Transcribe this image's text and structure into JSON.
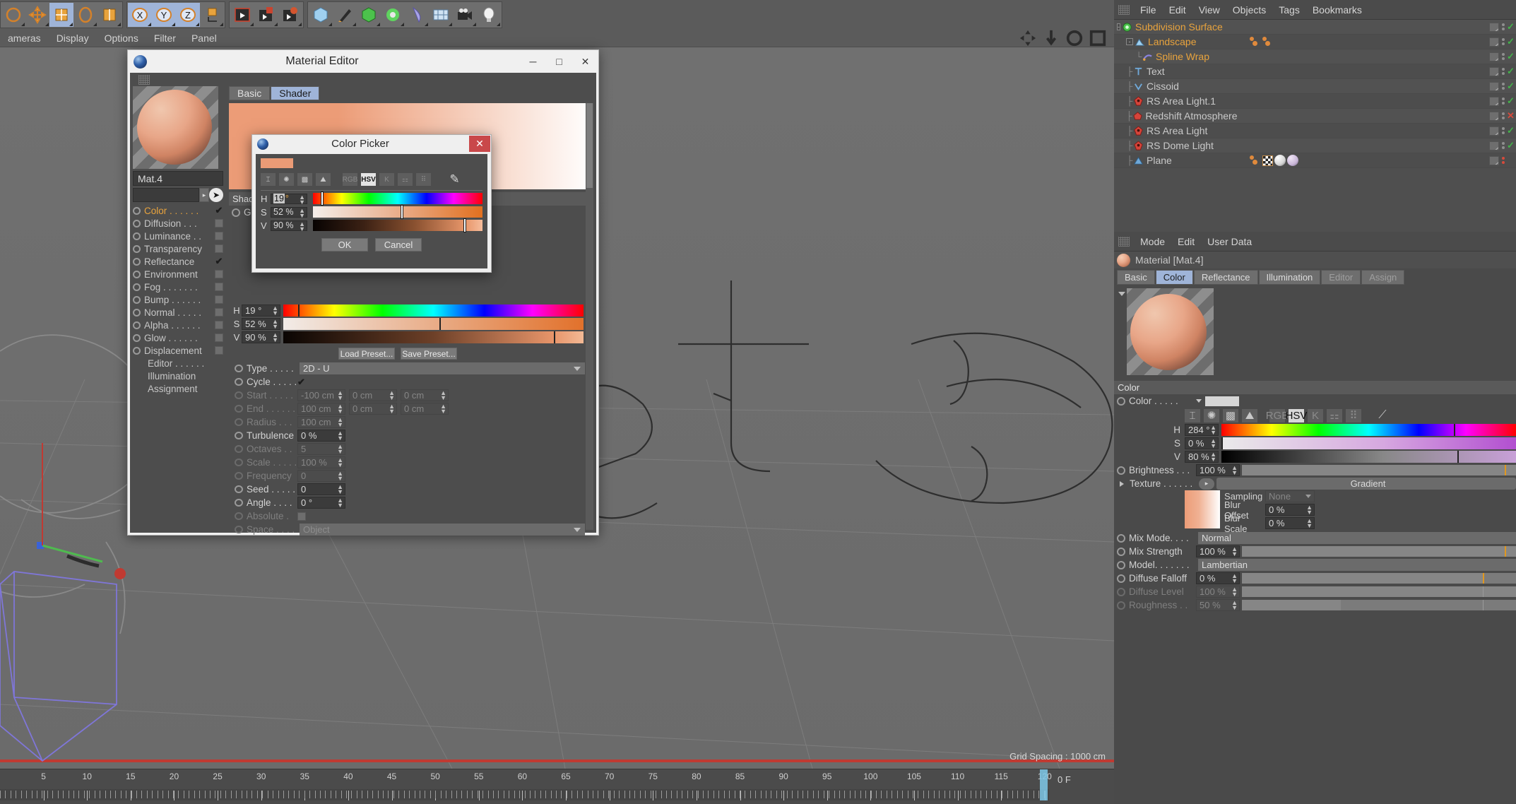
{
  "toolbar": {
    "groups": [
      {
        "name": "transform",
        "buttons": [
          {
            "icon": "undo-icon",
            "selected": false
          },
          {
            "icon": "move-icon",
            "selected": false
          },
          {
            "icon": "scale-icon",
            "selected": true
          },
          {
            "icon": "rotate-icon",
            "selected": false
          },
          {
            "icon": "scale2-icon",
            "selected": false
          }
        ]
      },
      {
        "name": "axis",
        "buttons": [
          {
            "icon": "x-axis-icon",
            "label": "X",
            "selected": true
          },
          {
            "icon": "y-axis-icon",
            "label": "Y",
            "selected": true
          },
          {
            "icon": "z-axis-icon",
            "label": "Z",
            "selected": true
          },
          {
            "icon": "world-axis-icon",
            "selected": false
          }
        ]
      },
      {
        "name": "render",
        "buttons": [
          {
            "icon": "render-view-icon",
            "selected": false
          },
          {
            "icon": "render-picture-viewer-icon",
            "selected": false
          },
          {
            "icon": "render-settings-icon",
            "selected": false
          }
        ]
      },
      {
        "name": "objects",
        "buttons": [
          {
            "icon": "cube-icon",
            "selected": false
          },
          {
            "icon": "pen-spline-icon",
            "selected": false
          },
          {
            "icon": "generator-icon",
            "selected": false
          },
          {
            "icon": "deformer-icon",
            "selected": false
          },
          {
            "icon": "bend-icon",
            "selected": false
          },
          {
            "icon": "environment-icon",
            "selected": false
          },
          {
            "icon": "camera-icon",
            "selected": false
          },
          {
            "icon": "light-icon",
            "selected": false
          }
        ]
      }
    ]
  },
  "viewport_menu": {
    "items": [
      "ameras",
      "Display",
      "Options",
      "Filter",
      "Panel"
    ],
    "right_icons": [
      "axis-move-icon",
      "arrow-down-icon",
      "rotate-icon",
      "panel-icon"
    ]
  },
  "viewport": {
    "grid_spacing_label": "Grid Spacing : 1000 cm"
  },
  "timeline": {
    "ticks": [
      "5",
      "10",
      "15",
      "20",
      "25",
      "30",
      "35",
      "40",
      "45",
      "50",
      "55",
      "60",
      "65",
      "70",
      "75",
      "80",
      "85",
      "90",
      "95",
      "100",
      "105",
      "110",
      "115",
      "120"
    ],
    "current_frame": "0 F"
  },
  "object_manager": {
    "menu": [
      "File",
      "Edit",
      "View",
      "Objects",
      "Tags",
      "Bookmarks"
    ],
    "rows": [
      {
        "label": "Subdivision Surface",
        "icon": "subdivision-surface-icon",
        "color": "orange",
        "depth": 0,
        "expander": "-",
        "state": "check",
        "tags": []
      },
      {
        "label": "Landscape",
        "icon": "landscape-icon",
        "color": "orange",
        "depth": 1,
        "expander": "-",
        "state": "check",
        "tags": [
          "material-orange",
          "material-orange"
        ]
      },
      {
        "label": "Spline Wrap",
        "icon": "spline-wrap-icon",
        "color": "orange",
        "depth": 2,
        "expander": "",
        "state": "check",
        "tags": []
      },
      {
        "label": "Text",
        "icon": "text-icon",
        "color": "grey",
        "depth": 1,
        "expander": "",
        "state": "check",
        "tags": []
      },
      {
        "label": "Cissoid",
        "icon": "cissoid-icon",
        "color": "grey",
        "depth": 1,
        "expander": "",
        "state": "check",
        "tags": []
      },
      {
        "label": "RS Area Light.1",
        "icon": "light-red-icon",
        "color": "grey",
        "depth": 1,
        "expander": "",
        "state": "check",
        "tags": []
      },
      {
        "label": "Redshift Atmosphere",
        "icon": "atmosphere-icon",
        "color": "grey",
        "depth": 1,
        "expander": "",
        "state": "cross",
        "tags": []
      },
      {
        "label": "RS Area Light",
        "icon": "light-red-icon",
        "color": "grey",
        "depth": 1,
        "expander": "",
        "state": "check",
        "tags": []
      },
      {
        "label": "RS Dome Light",
        "icon": "light-red-icon",
        "color": "grey",
        "depth": 1,
        "expander": "",
        "state": "check",
        "tags": []
      },
      {
        "label": "Plane",
        "icon": "plane-icon",
        "color": "grey",
        "depth": 1,
        "expander": "",
        "state": "reddots",
        "tags": [
          "material-orange",
          "checker-tag",
          "white-ball",
          "lilac-ball"
        ]
      }
    ]
  },
  "attribute_manager": {
    "menu": [
      "Mode",
      "Edit",
      "User Data"
    ],
    "header": "Material [Mat.4]",
    "tabs": [
      {
        "label": "Basic",
        "active": false
      },
      {
        "label": "Color",
        "active": true
      },
      {
        "label": "Reflectance",
        "active": false
      },
      {
        "label": "Illumination",
        "active": false
      },
      {
        "label": "Editor",
        "active": false,
        "dim": true
      },
      {
        "label": "Assign",
        "active": false,
        "dim": true
      }
    ],
    "section_title": "Color",
    "color_row_label": "Color . . . . .",
    "color_swatch": "#d6d6d6",
    "color_modes": [
      {
        "name": "range-icon",
        "active": false
      },
      {
        "name": "color-wheel-icon",
        "active": false
      },
      {
        "name": "gradient-icon",
        "active": false
      },
      {
        "name": "image-picker-icon",
        "active": false
      },
      {
        "name": "RGB",
        "active": false,
        "dim": true
      },
      {
        "name": "HSV",
        "active": true
      },
      {
        "name": "K",
        "active": false,
        "dim": true
      },
      {
        "name": "sliders-icon",
        "active": false,
        "dim": true
      },
      {
        "name": "swatches-icon",
        "active": false,
        "dim": true
      },
      {
        "name": "eyedropper-icon",
        "active": false
      }
    ],
    "hsv": [
      {
        "channel": "H",
        "value": "284 °",
        "cursor_pct": 78.9
      },
      {
        "channel": "S",
        "value": "0 %",
        "cursor_pct": 0
      },
      {
        "channel": "V",
        "value": "80 %",
        "cursor_pct": 80
      }
    ],
    "params": [
      {
        "label": "Brightness . . .",
        "value": "100 %",
        "type": "slider",
        "fill": 100,
        "mark": 96,
        "dim": false,
        "radio": true
      },
      {
        "label": "Texture . . . . . .",
        "value": "Gradient",
        "type": "texture",
        "dim": false,
        "radio": false
      },
      {
        "label": "Mix Mode. . . .",
        "value": "Normal",
        "type": "combo",
        "dim": false,
        "radio": true
      },
      {
        "label": "Mix Strength",
        "value": "100 %",
        "type": "slider",
        "fill": 100,
        "mark": 96,
        "dim": false,
        "radio": true
      },
      {
        "label": "Model. . . . . . .",
        "value": "Lambertian",
        "type": "combo",
        "dim": false,
        "radio": true
      },
      {
        "label": "Diffuse Falloff",
        "value": "0 %",
        "type": "slider",
        "fill": 88,
        "mark": 88,
        "dim": false,
        "radio": true
      },
      {
        "label": "Diffuse Level",
        "value": "100 %",
        "type": "slider",
        "fill": 100,
        "mark": 88,
        "dim": true,
        "radio": true
      },
      {
        "label": "Roughness . .",
        "value": "50 %",
        "type": "slider",
        "fill": 36,
        "mark": 88,
        "dim": true,
        "radio": true
      }
    ],
    "texture_sub": {
      "sampling_label": "Sampling",
      "sampling_value": "None",
      "blur_offset_label": "Blur Offset",
      "blur_offset_value": "0 %",
      "blur_scale_label": "Blur Scale",
      "blur_scale_value": "0 %"
    }
  },
  "material_editor": {
    "title": "Material Editor",
    "window_buttons": {
      "minimize": "─",
      "maximize": "□",
      "close": "✕"
    },
    "tabs": [
      {
        "label": "Basic",
        "active": false
      },
      {
        "label": "Shader",
        "active": true
      }
    ],
    "material_name": "Mat.4",
    "channels": [
      {
        "label": "Color . . . . . .",
        "checked": true,
        "highlight": true
      },
      {
        "label": "Diffusion . . .",
        "checked": false,
        "highlight": false
      },
      {
        "label": "Luminance . .",
        "checked": false,
        "highlight": false
      },
      {
        "label": "Transparency",
        "checked": false,
        "highlight": false
      },
      {
        "label": "Reflectance",
        "checked": true,
        "highlight": false
      },
      {
        "label": "Environment",
        "checked": false,
        "highlight": false
      },
      {
        "label": "Fog . . . . . . .",
        "checked": false,
        "highlight": false
      },
      {
        "label": "Bump . . . . . .",
        "checked": false,
        "highlight": false
      },
      {
        "label": "Normal . . . . .",
        "checked": false,
        "highlight": false
      },
      {
        "label": "Alpha . . . . . .",
        "checked": false,
        "highlight": false
      },
      {
        "label": "Glow . . . . . .",
        "checked": false,
        "highlight": false
      },
      {
        "label": "Displacement",
        "checked": false,
        "highlight": false
      }
    ],
    "plain_items": [
      "Editor . . . . . .",
      "Illumination",
      "Assignment"
    ],
    "shader_section_label": "Shader",
    "gradient_row_label": "Gra",
    "hsv": [
      {
        "channel": "H",
        "value": "19 °",
        "cursor_pct": 5
      },
      {
        "channel": "S",
        "value": "52 %",
        "cursor_pct": 52
      },
      {
        "channel": "V",
        "value": "90 %",
        "cursor_pct": 90
      }
    ],
    "preset_buttons": [
      "Load Preset...",
      "Save Preset..."
    ],
    "params": [
      {
        "label": "Type . . . . .",
        "value": "2D - U",
        "type": "combo",
        "dim": false,
        "radio": "on"
      },
      {
        "label": "Cycle . . . . . .",
        "value": "",
        "type": "check",
        "checked": true,
        "dim": false,
        "radio": "on"
      },
      {
        "label": "Start . . . . .",
        "value": "-100 cm",
        "v2": "0 cm",
        "v3": "0 cm",
        "type": "vector",
        "dim": true,
        "radio": "off"
      },
      {
        "label": "End . . . . . .",
        "value": "100 cm",
        "v2": "0 cm",
        "v3": "0 cm",
        "type": "vector",
        "dim": true,
        "radio": "off"
      },
      {
        "label": "Radius . . .",
        "value": "100 cm",
        "type": "num",
        "dim": true,
        "radio": "off"
      },
      {
        "label": "Turbulence",
        "value": "0 %",
        "type": "num",
        "dim": false,
        "radio": "on"
      },
      {
        "label": "Octaves . .",
        "value": "5",
        "type": "num",
        "dim": true,
        "radio": "off"
      },
      {
        "label": "Scale . . . . .",
        "value": "100 %",
        "type": "num",
        "dim": true,
        "radio": "off"
      },
      {
        "label": "Frequency",
        "value": "0",
        "type": "num",
        "dim": true,
        "radio": "off"
      },
      {
        "label": "Seed . . . . .",
        "value": "0",
        "type": "num",
        "dim": false,
        "radio": "on"
      },
      {
        "label": "Angle . . . .",
        "value": "0 °",
        "type": "num",
        "dim": false,
        "radio": "on"
      },
      {
        "label": "Absolute .",
        "value": "",
        "type": "check",
        "checked": false,
        "dim": true,
        "radio": "off"
      },
      {
        "label": "Space . . . .",
        "value": "Object",
        "type": "combo",
        "dim": true,
        "radio": "off"
      }
    ]
  },
  "color_picker": {
    "title": "Color Picker",
    "close_label": "✕",
    "swatch": "#eb9b76",
    "modes": [
      {
        "name": "range-icon",
        "active": false,
        "glyph": "⌶"
      },
      {
        "name": "color-wheel-icon",
        "active": false,
        "glyph": "✺"
      },
      {
        "name": "gradient-icon",
        "active": false,
        "glyph": "▩"
      },
      {
        "name": "image-picker-icon",
        "active": false,
        "glyph": "⛰"
      },
      {
        "name": "RGB",
        "active": false,
        "dim": true,
        "glyph": "RGB"
      },
      {
        "name": "HSV",
        "active": true,
        "glyph": "HSV"
      },
      {
        "name": "K",
        "active": false,
        "dim": true,
        "glyph": "K"
      },
      {
        "name": "sliders-icon",
        "active": false,
        "dim": true,
        "glyph": "⚏"
      },
      {
        "name": "swatches-icon",
        "active": false,
        "dim": true,
        "glyph": "⠿"
      },
      {
        "name": "eyedropper-icon",
        "active": false,
        "glyph": "✎"
      }
    ],
    "hsv": [
      {
        "channel": "H",
        "value": "19",
        "unit": "°",
        "cursor_pct": 5.2,
        "selected": true
      },
      {
        "channel": "S",
        "value": "52 %",
        "unit": "",
        "cursor_pct": 52,
        "selected": false
      },
      {
        "channel": "V",
        "value": "90 %",
        "unit": "",
        "cursor_pct": 89,
        "selected": false
      }
    ],
    "ok_label": "OK",
    "cancel_label": "Cancel"
  }
}
